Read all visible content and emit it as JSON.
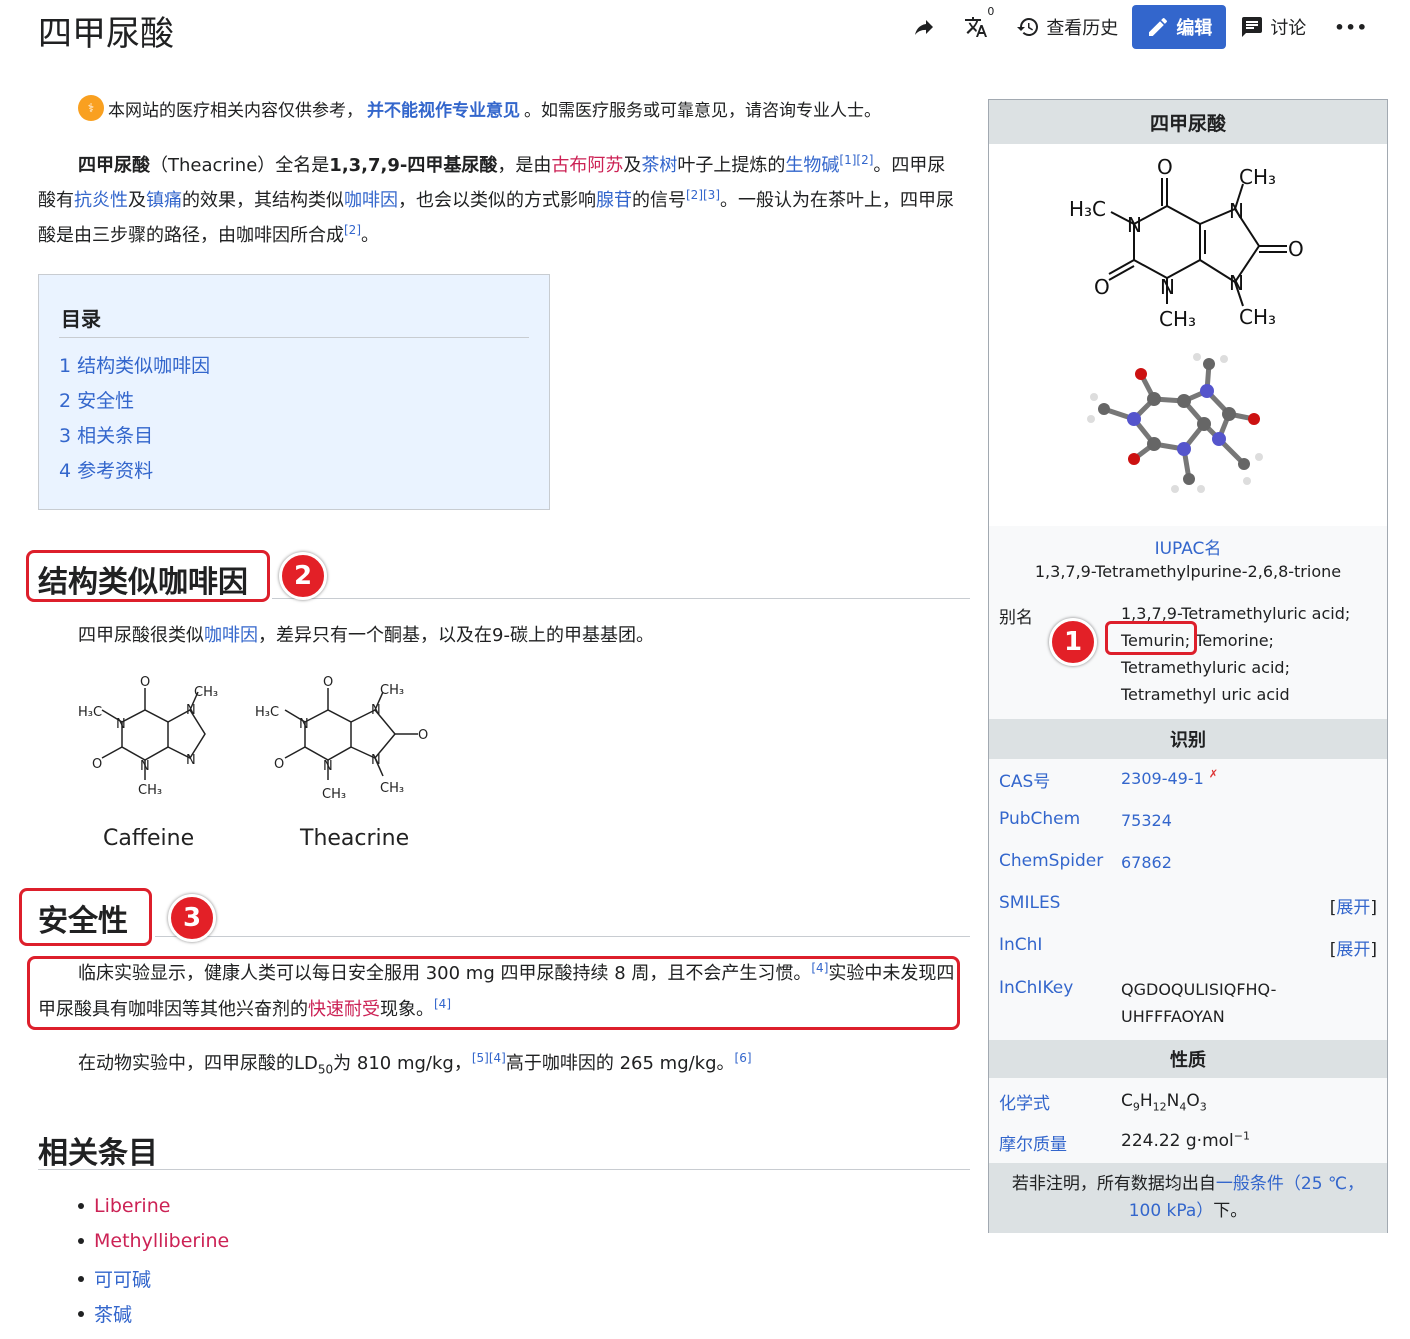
{
  "page": {
    "title": "四甲尿酸"
  },
  "toolbar": {
    "lang_badge": "0",
    "history_label": "查看历史",
    "edit_label": "编辑",
    "talk_label": "讨论",
    "more_label": "•••"
  },
  "notice": {
    "part1": "本网站的医疗相关内容仅供参考，",
    "bold": "并不能视作专业意见",
    "part2": "。如需医疗服务或可靠意见，请咨询专业人士。"
  },
  "intro": {
    "s1": "四甲尿酸",
    "s2": "（Theacrine）全名是",
    "s3": "1,3,7,9-四甲基尿酸",
    "s4": "，是由",
    "l1": "古布阿苏",
    "s5": "及",
    "l2": "茶树",
    "s6": "叶子上提炼的",
    "l3": "生物碱",
    "r1": "[1][2]",
    "s7": "。四甲尿酸有",
    "l4": "抗炎性",
    "s8": "及",
    "l5": "镇痛",
    "s9": "的效果，其结构类似",
    "l6": "咖啡因",
    "s10": "，也会以类似的方式影响",
    "l7": "腺苷",
    "s11": "的信号",
    "r2": "[2][3]",
    "s12": "。一般认为在茶叶上，四甲尿酸是由三步骤的路径，由咖啡因所合成",
    "r3": "[2]",
    "s13": "。"
  },
  "toc": {
    "title": "目录",
    "items": [
      "1 结构类似咖啡因",
      "2 安全性",
      "3 相关条目",
      "4 参考资料"
    ]
  },
  "section1": {
    "heading": "结构类似咖啡因",
    "p1": "四甲尿酸很类似",
    "p1_link": "咖啡因",
    "p2": "，差异只有一个酮基，以及在9-碳上的甲基基团。",
    "caffeine_label": "Caffeine",
    "theacrine_label": "Theacrine"
  },
  "section2": {
    "heading": "安全性",
    "p1a": "临床实验显示，健康人类可以每日安全服用 300 mg 四甲尿酸持续 8 周，且不会产生习惯。",
    "p1_ref1": "[4]",
    "p1b": "实验中未发现四甲尿酸具有咖啡因等其他兴奋剂的",
    "p1_link": "快速耐受",
    "p1c": "现象。",
    "p1_ref2": "[4]",
    "p2a": "在动物实验中，四甲尿酸的LD",
    "p2_sub": "50",
    "p2b": "为 810 mg/kg，",
    "p2_ref1": "[5][4]",
    "p2c": "高于咖啡因的 265 mg/kg。",
    "p2_ref2": "[6]"
  },
  "section3": {
    "heading": "相关条目",
    "items": [
      "Liberine",
      "Methylliberine",
      "可可碱",
      "茶碱"
    ]
  },
  "annotations": [
    "1",
    "2",
    "3"
  ],
  "infobox": {
    "title": "四甲尿酸",
    "mol_text": {
      "o": "O",
      "n": "N",
      "h3c": "H₃C",
      "ch3": "CH₃"
    },
    "iupac_label": "IUPAC名",
    "iupac_value": "1,3,7,9-Tetramethylpurine-2,6,8-trione",
    "alias_label": "别名",
    "alias_lines": [
      "1,3,7,9-Tetramethyluric acid;",
      "Temurin; Temorine;",
      "Tetramethyluric acid;",
      "Tetramethyl uric acid"
    ],
    "ident_head": "识别",
    "cas_label": "CAS号",
    "cas_value": "2309-49-1",
    "cas_mark": "✗",
    "pubchem_label": "PubChem",
    "pubchem_value": "75324",
    "chemspider_label": "ChemSpider",
    "chemspider_value": "67862",
    "smiles_label": "SMILES",
    "inchi_label": "InChI",
    "expand_label": "[展开]",
    "inchikey_label": "InChIKey",
    "inchikey_line1": "QGDOQULISIQFHQ-",
    "inchikey_line2": "UHFFFAOYAN",
    "props_head": "性质",
    "formula_label": "化学式",
    "formula": {
      "c": "C",
      "c_n": "9",
      "h": "H",
      "h_n": "12",
      "n": "N",
      "n_n": "4",
      "o": "O",
      "o_n": "3"
    },
    "molar_label": "摩尔质量",
    "molar_value": "224.22 g·mol",
    "molar_exp": "−1",
    "footer_a": "若非注明，所有数据均出自",
    "footer_link": "一般条件（25 ℃，100 kPa）",
    "footer_b": "下。"
  }
}
